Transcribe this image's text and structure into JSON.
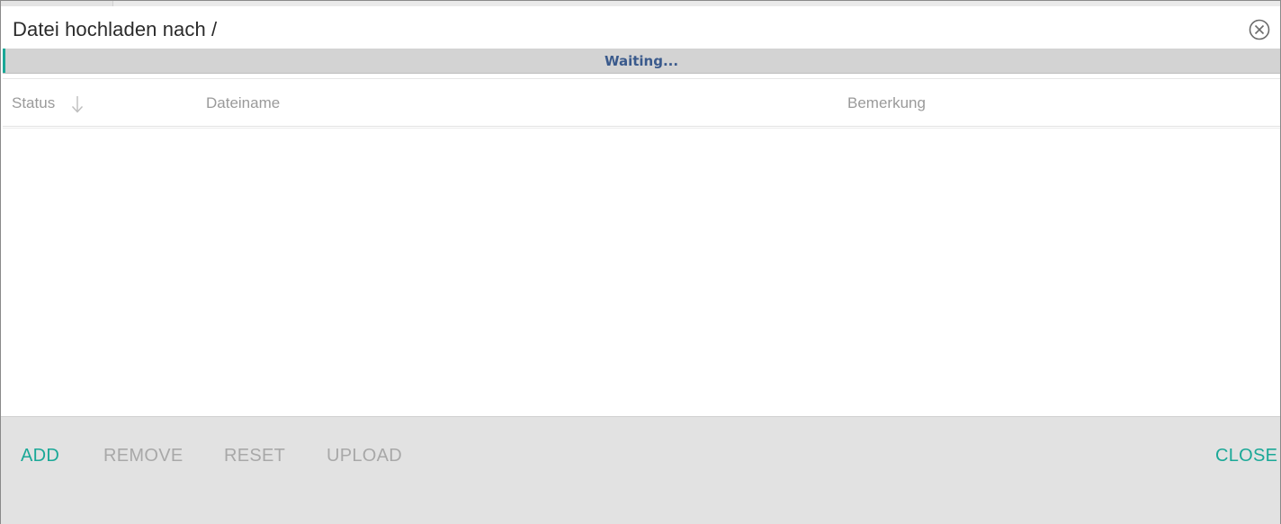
{
  "dialog": {
    "title": "Datei hochladen nach /"
  },
  "progress": {
    "text": "Waiting...",
    "value": 0.002,
    "fill_color": "#1aa897",
    "text_color": "#3a5a8c"
  },
  "grid": {
    "columns": [
      {
        "label": "Status",
        "sorted": "descending"
      },
      {
        "label": "Dateiname"
      },
      {
        "label": "Bemerkung"
      }
    ],
    "rows": []
  },
  "footer": {
    "add_label": "ADD",
    "remove_label": "REMOVE",
    "reset_label": "RESET",
    "upload_label": "UPLOAD",
    "close_label": "CLOSE",
    "enabled_color": "#1aa897",
    "disabled_color": "#a8a8a8"
  },
  "icons": {
    "close": "close-circle-icon",
    "sort": "arrow-down-icon"
  }
}
